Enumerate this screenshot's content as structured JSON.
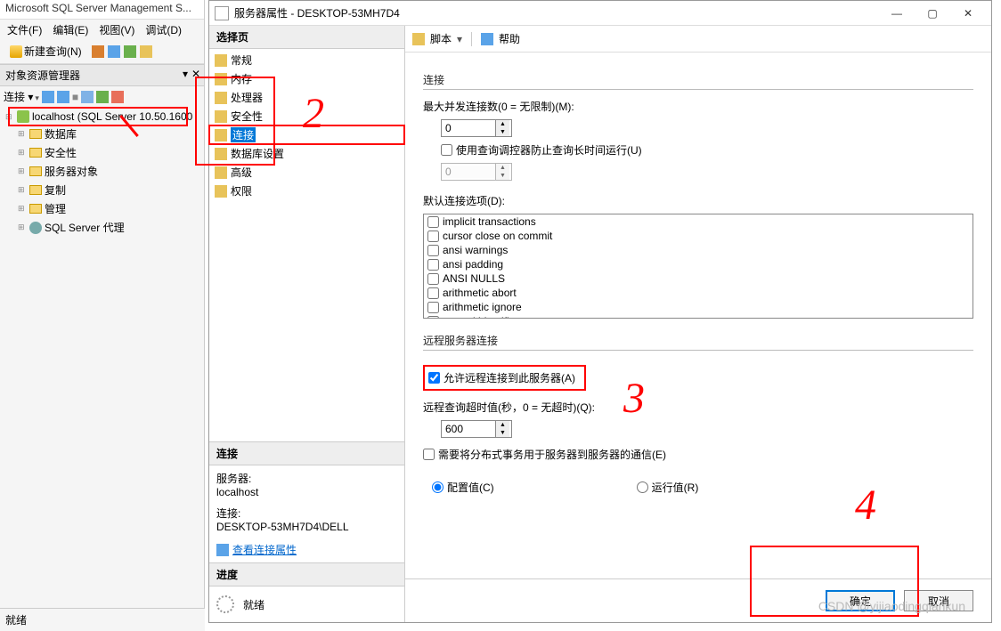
{
  "ssms": {
    "title": "Microsoft SQL Server Management S...",
    "menu": [
      "文件(F)",
      "编辑(E)",
      "视图(V)",
      "调试(D)"
    ],
    "new_query": "新建查询(N)",
    "object_explorer": "对象资源管理器",
    "connect_label": "连接 ▾",
    "server_node": "localhost (SQL Server 10.50.1600",
    "tree_nodes": [
      "数据库",
      "安全性",
      "服务器对象",
      "复制",
      "管理",
      "SQL Server 代理"
    ],
    "status": "就绪"
  },
  "dialog": {
    "title": "服务器属性 - DESKTOP-53MH7D4",
    "select_page": "选择页",
    "pages": [
      "常规",
      "内存",
      "处理器",
      "安全性",
      "连接",
      "数据库设置",
      "高级",
      "权限"
    ],
    "selected_page_index": 4,
    "toolbar": {
      "script": "脚本",
      "help": "帮助"
    },
    "conn_section": "连接",
    "server_label": "服务器:",
    "server_value": "localhost",
    "conn_label": "连接:",
    "conn_value": "DESKTOP-53MH7D4\\DELL",
    "view_props": "查看连接属性",
    "progress_section": "进度",
    "progress_status": "就绪",
    "content": {
      "group_conn": "连接",
      "max_conn_label": "最大并发连接数(0 = 无限制)(M):",
      "max_conn_value": "0",
      "use_governor": "使用查询调控器防止查询长时间运行(U)",
      "governor_value": "0",
      "default_opts_label": "默认连接选项(D):",
      "opts": [
        "implicit transactions",
        "cursor close on commit",
        "ansi warnings",
        "ansi padding",
        "ANSI NULLS",
        "arithmetic abort",
        "arithmetic ignore",
        "quoted identifier"
      ],
      "group_remote": "远程服务器连接",
      "allow_remote": "允许远程连接到此服务器(A)",
      "remote_timeout_label": "远程查询超时值(秒，0 = 无超时)(Q):",
      "remote_timeout_value": "600",
      "require_dtc": "需要将分布式事务用于服务器到服务器的通信(E)",
      "config_value": "配置值(C)",
      "run_value": "运行值(R)"
    },
    "buttons": {
      "ok": "确定",
      "cancel": "取消"
    }
  },
  "watermark": "CSDN @yijiaodingqiankun",
  "annotations": {
    "n2": "2",
    "n3": "3",
    "n4": "4"
  }
}
